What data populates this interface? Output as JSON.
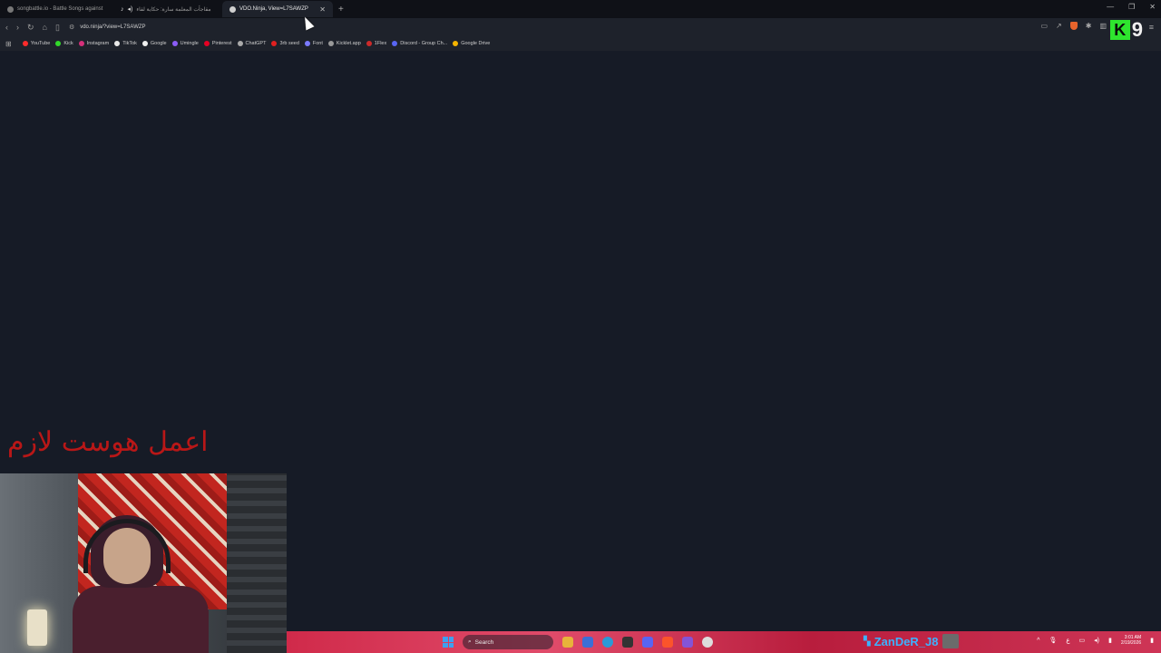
{
  "browser": {
    "tabs": [
      {
        "title": "songbattle.io - Battle Songs against",
        "active": false
      },
      {
        "title": "مقاجأت المعلمة سارة: حكاية لقاء",
        "active": false
      },
      {
        "title": "VDO.Ninja, View=L7SAWZP",
        "active": true
      }
    ],
    "new_tab_label": "+",
    "address": "vdo.ninja/?view=L7SAWZP",
    "bookmarks": [
      {
        "label": "YouTube",
        "color": "#ff2b2b"
      },
      {
        "label": "Kick",
        "color": "#31d82a"
      },
      {
        "label": "Instagram",
        "color": "#d6307a"
      },
      {
        "label": "TikTok",
        "color": "#e8e8e8"
      },
      {
        "label": "Google",
        "color": "#f0f0f0"
      },
      {
        "label": "Umingle",
        "color": "#8b5cf6"
      },
      {
        "label": "Pinterest",
        "color": "#e60023"
      },
      {
        "label": "ChatGPT",
        "color": "#aaaaaa"
      },
      {
        "label": "3rb seed",
        "color": "#e02020"
      },
      {
        "label": "Font",
        "color": "#7a7aff"
      },
      {
        "label": "Kicklet.app",
        "color": "#999999"
      },
      {
        "label": "1Flex",
        "color": "#cc2a2a"
      },
      {
        "label": "Discord - Group Ch...",
        "color": "#5865f2"
      },
      {
        "label": "Google Drive",
        "color": "#f4b400"
      }
    ]
  },
  "overlay": {
    "arabic_text": "اعمل هوست لازم",
    "logo_letter": "K",
    "logo_number": "9"
  },
  "taskbar": {
    "search_label": "Search",
    "username": "ZanDeR_J8",
    "lang": "ع",
    "clock_time": "3:01 AM",
    "clock_date": "2/19/2026"
  }
}
